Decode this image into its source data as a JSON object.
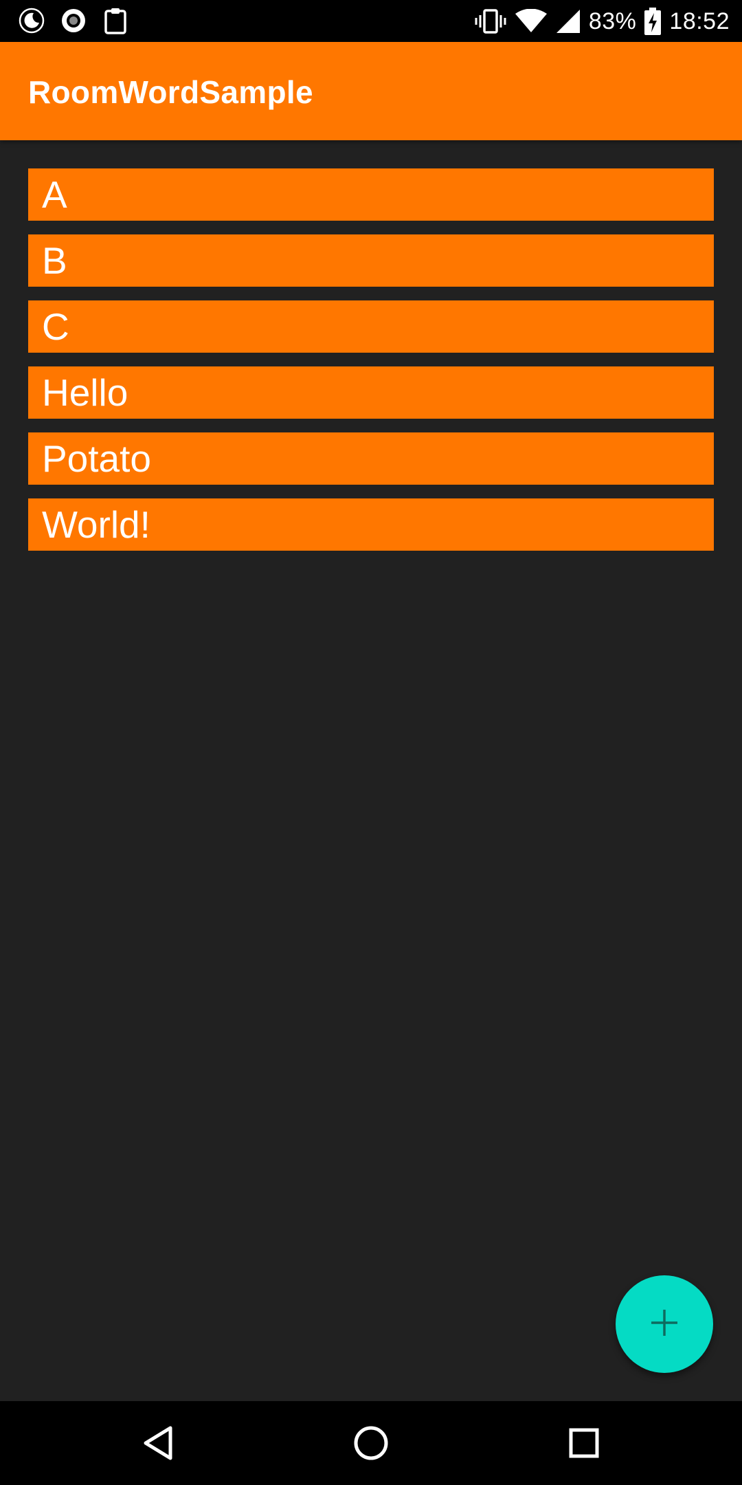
{
  "status_bar": {
    "battery_percent": "83%",
    "time": "18:52",
    "left_icons": [
      "night-mode-icon",
      "record-icon",
      "clipboard-icon"
    ],
    "right_icons": [
      "vibrate-icon",
      "wifi-icon",
      "cellular-signal-icon",
      "battery-charging-icon"
    ]
  },
  "app_bar": {
    "title": "RoomWordSample"
  },
  "words": [
    "A",
    "B",
    "C",
    "Hello",
    "Potato",
    "World!"
  ],
  "fab": {
    "icon": "add-icon"
  },
  "nav_bar": {
    "icons": [
      "back-icon",
      "home-icon",
      "recents-icon"
    ]
  },
  "colors": {
    "primary": "#ff7700",
    "accent": "#05dbc4",
    "background": "#212121"
  }
}
